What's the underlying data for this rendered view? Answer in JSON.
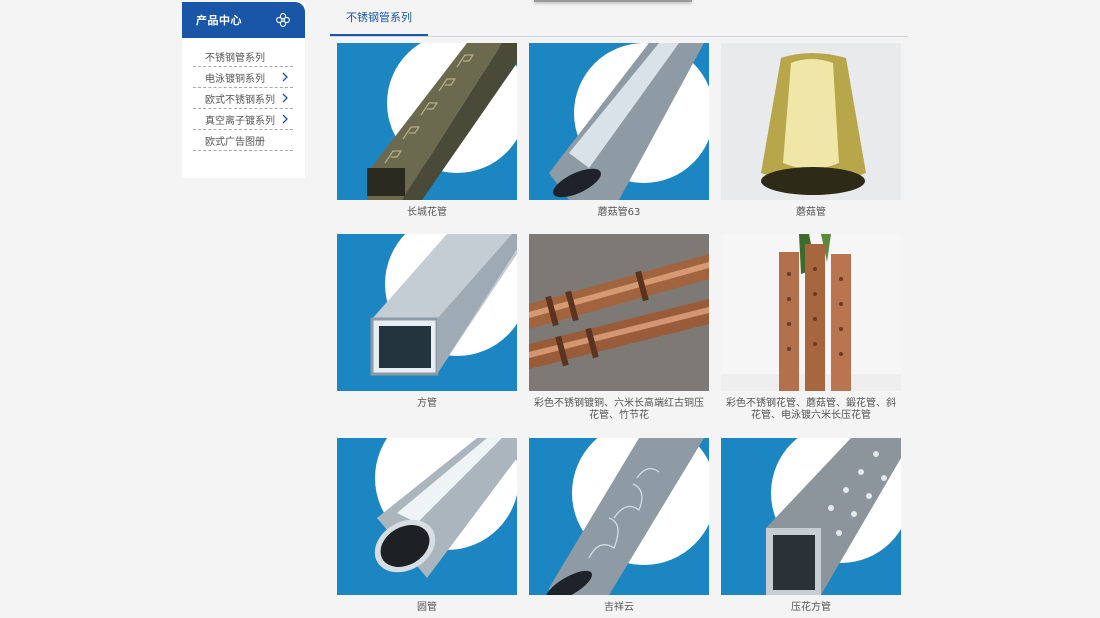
{
  "sidebar": {
    "title": "产品中心",
    "items": [
      {
        "label": "不锈钢管系列",
        "has_arrow": false
      },
      {
        "label": "电泳镀铜系列",
        "has_arrow": true
      },
      {
        "label": "欧式不锈钢系列",
        "has_arrow": true
      },
      {
        "label": "真空离子镀系列",
        "has_arrow": true
      },
      {
        "label": "欧式广告图册",
        "has_arrow": false
      }
    ]
  },
  "main": {
    "tab_label": "不锈钢管系列",
    "products": [
      {
        "name": "长城花管",
        "image": "gold-square-tube-with-greek-key-pattern"
      },
      {
        "name": "蘑菇管63",
        "image": "silver-mushroom-tube"
      },
      {
        "name": "蘑菇管",
        "image": "gold-mushroom-tube"
      },
      {
        "name": "方管",
        "image": "silver-square-tube"
      },
      {
        "name": "彩色不锈钢镀铜、六米长高端红古铜压花管、竹节花",
        "image": "bronze-bamboo-pipes"
      },
      {
        "name": "彩色不锈钢花管、蘑菇管、鍛花管、斜花管、电泳镀六米长压花管",
        "image": "copper-pressed-tubes"
      },
      {
        "name": "圆管",
        "image": "silver-round-tube"
      },
      {
        "name": "吉祥云",
        "image": "embossed-auspicious-cloud-tube"
      },
      {
        "name": "压花方管",
        "image": "embossed-square-tube"
      }
    ]
  },
  "colors": {
    "brand_blue": "#1a56a8",
    "photo_bg_blue": "#1e7fb8"
  }
}
